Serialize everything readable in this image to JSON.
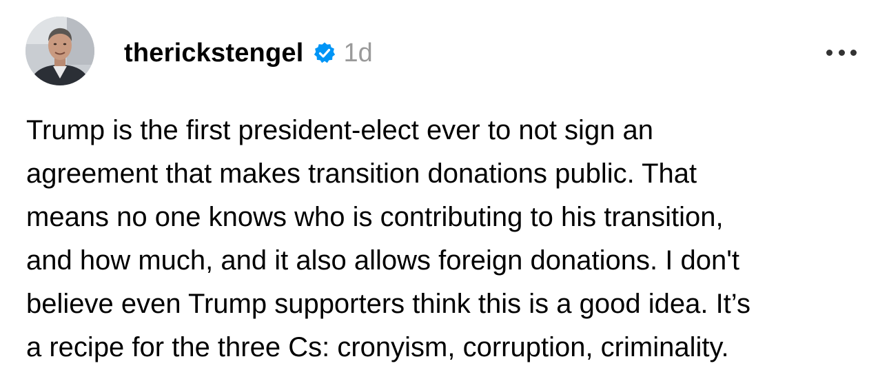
{
  "post": {
    "username": "therickstengel",
    "timestamp": "1d",
    "verified": true,
    "icons": {
      "verified": "verified-badge-icon",
      "more": "more-options-icon"
    },
    "colors": {
      "verified_badge": "#0095F6",
      "timestamp": "#9a9a9a"
    },
    "text_lines": [
      "Trump is the first president-elect ever to not sign an",
      "agreement that makes transition donations public. That",
      "means no one knows who is contributing to his transition,",
      "and how much, and it also allows foreign donations. I don't",
      "believe even Trump supporters think this is a good idea. It’s",
      "a recipe for the three Cs: cronyism, corruption, criminality."
    ]
  }
}
